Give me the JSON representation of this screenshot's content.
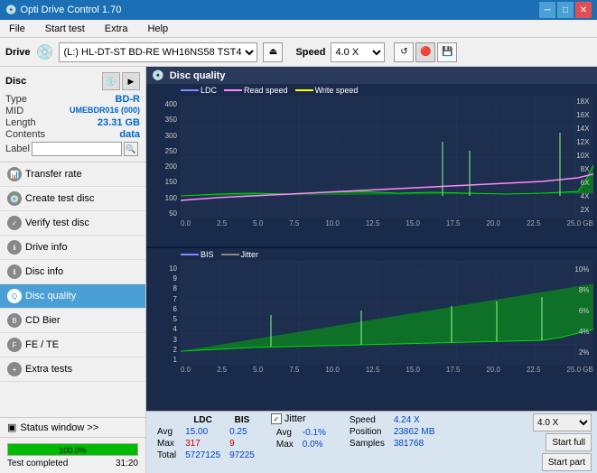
{
  "titleBar": {
    "title": "Opti Drive Control 1.70",
    "minBtn": "─",
    "maxBtn": "□",
    "closeBtn": "✕"
  },
  "menuBar": {
    "items": [
      "File",
      "Start test",
      "Extra",
      "Help"
    ]
  },
  "driveBar": {
    "label": "Drive",
    "driveValue": "(L:)  HL-DT-ST BD-RE  WH16NS58 TST4",
    "ejectSymbol": "⏏",
    "speedLabel": "Speed",
    "speedValue": "4.0 X"
  },
  "discSection": {
    "typeLabel": "Type",
    "typeValue": "BD-R",
    "midLabel": "MID",
    "midValue": "UMEBDR016 (000)",
    "lengthLabel": "Length",
    "lengthValue": "23.31 GB",
    "contentsLabel": "Contents",
    "contentsValue": "data",
    "labelLabel": "Label",
    "labelValue": "",
    "labelPlaceholder": ""
  },
  "navItems": [
    {
      "id": "transfer-rate",
      "label": "Transfer rate",
      "active": false
    },
    {
      "id": "create-test-disc",
      "label": "Create test disc",
      "active": false
    },
    {
      "id": "verify-test-disc",
      "label": "Verify test disc",
      "active": false
    },
    {
      "id": "drive-info",
      "label": "Drive info",
      "active": false
    },
    {
      "id": "disc-info",
      "label": "Disc info",
      "active": false
    },
    {
      "id": "disc-quality",
      "label": "Disc quality",
      "active": true
    },
    {
      "id": "cd-bier",
      "label": "CD Bier",
      "active": false
    },
    {
      "id": "fe-te",
      "label": "FE / TE",
      "active": false
    },
    {
      "id": "extra-tests",
      "label": "Extra tests",
      "active": false
    }
  ],
  "statusSection": {
    "statusWindowLabel": "Status window >>",
    "progressPercent": "100.0%",
    "completedText": "Test completed",
    "timeValue": "31:20"
  },
  "chartHeader": {
    "title": "Disc quality"
  },
  "topChart": {
    "legendItems": [
      {
        "id": "ldc",
        "label": "LDC",
        "color": "#8888ff"
      },
      {
        "id": "read-speed",
        "label": "Read speed",
        "color": "#ff88ff"
      },
      {
        "id": "write-speed",
        "label": "Write speed",
        "color": "#ffff88"
      }
    ],
    "yAxisLeft": [
      "400",
      "350",
      "300",
      "250",
      "200",
      "150",
      "100",
      "50"
    ],
    "yAxisRight": [
      "18X",
      "16X",
      "14X",
      "12X",
      "10X",
      "8X",
      "6X",
      "4X",
      "2X"
    ],
    "xAxisLabels": [
      "0.0",
      "2.5",
      "5.0",
      "7.5",
      "10.0",
      "12.5",
      "15.0",
      "17.5",
      "20.0",
      "22.5",
      "25.0 GB"
    ]
  },
  "bottomChart": {
    "legendItems": [
      {
        "id": "bis",
        "label": "BIS",
        "color": "#88bbff"
      },
      {
        "id": "jitter",
        "label": "Jitter",
        "color": "#88ff88"
      }
    ],
    "yAxisLeft": [
      "10",
      "9",
      "8",
      "7",
      "6",
      "5",
      "4",
      "3",
      "2",
      "1"
    ],
    "yAxisRight": [
      "10%",
      "8%",
      "6%",
      "4%",
      "2%"
    ],
    "xAxisLabels": [
      "0.0",
      "2.5",
      "5.0",
      "7.5",
      "10.0",
      "12.5",
      "15.0",
      "17.5",
      "20.0",
      "22.5",
      "25.0 GB"
    ]
  },
  "statsTable": {
    "headers": [
      "",
      "LDC",
      "BIS",
      "",
      "Jitter",
      "Speed"
    ],
    "rows": [
      {
        "label": "Avg",
        "ldc": "15.00",
        "bis": "0.25",
        "jitter": "-0.1%",
        "speed": "4.24 X"
      },
      {
        "label": "Max",
        "ldc": "317",
        "bis": "9",
        "jitter": "0.0%"
      },
      {
        "label": "Total",
        "ldc": "5727125",
        "bis": "97225",
        "jitter": ""
      }
    ],
    "positionLabel": "Position",
    "positionValue": "23862 MB",
    "samplesLabel": "Samples",
    "samplesValue": "381768",
    "jitterChecked": true,
    "jitterLabel": "Jitter",
    "speedDropdownValue": "4.0 X",
    "startFullBtn": "Start full",
    "startPartBtn": "Start part"
  }
}
